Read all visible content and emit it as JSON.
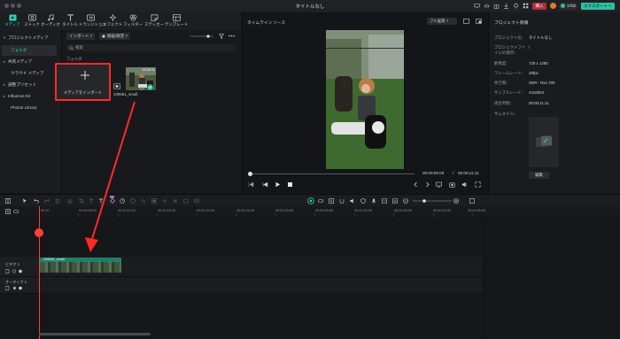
{
  "window": {
    "title": "タイトルなし"
  },
  "titlebar": {
    "buy_label": "購入",
    "credits": "1702",
    "export_label": "エクスポート ˅"
  },
  "toolbar": {
    "items": [
      {
        "label": "メディア"
      },
      {
        "label": "ストック"
      },
      {
        "label": "オーディオ"
      },
      {
        "label": "タイトル"
      },
      {
        "label": "トランジション"
      },
      {
        "label": "エフェクト"
      },
      {
        "label": "フィルター"
      },
      {
        "label": "ステッカー"
      },
      {
        "label": "テンプレート"
      }
    ]
  },
  "sidebar": {
    "items": [
      {
        "label": "プロジェクトメディア",
        "caret": "▾"
      },
      {
        "label": "フォルダ",
        "caret": ""
      },
      {
        "label": "共有メディア",
        "caret": "▸"
      },
      {
        "label": "クラウド メディア",
        "caret": ""
      },
      {
        "label": "調整プリセット",
        "caret": "▸"
      },
      {
        "label": "Influence Kit",
        "caret": "▸"
      },
      {
        "label": "Photos Library",
        "caret": ""
      }
    ]
  },
  "media": {
    "import_dropdown": "インポート ˅",
    "sort_dropdown": "録画/録音 ˅",
    "search_placeholder": "検索",
    "folder_label": "フォルダ",
    "import_card_label": "メディアをインポート",
    "thumb_duration": "00:00:11",
    "thumb_name": "239661_small"
  },
  "preview": {
    "tab_timeline": "タイムライン",
    "tab_source": "ソース",
    "quality": "フル画質 ˅",
    "current_time": "00:00:00:00",
    "separator": "/",
    "total_time": "00:00:11:11"
  },
  "project_info": {
    "title": "プロジェクト情報",
    "fields": [
      {
        "key": "プロジェクト名：",
        "value": "タイトルなし"
      },
      {
        "key": "プロジェクトファイルの場所：",
        "value": "/"
      },
      {
        "key": "解像度：",
        "value": "720 x 1280"
      },
      {
        "key": "フレームレート：",
        "value": "25fps"
      },
      {
        "key": "色空間：",
        "value": "SDR - Rec.709"
      },
      {
        "key": "サンプルレート：",
        "value": "44100Hz"
      },
      {
        "key": "再生時間：",
        "value": "00:00:11:11"
      },
      {
        "key": "サムネイル：",
        "value": ""
      }
    ],
    "edit_label": "編集"
  },
  "timeline": {
    "ruler": [
      "00:00",
      "00:00:05:00",
      "00:00:10:00",
      "00:00:15:00",
      "00:00:20:00",
      "00:00:25:00",
      "00:00:30:00",
      "00:00:35:00",
      "00:00:40:00",
      "00:00:45:00",
      "00:00:50:00",
      "00:00:55:00"
    ],
    "tracks": [
      {
        "label": "ビデオ 1"
      },
      {
        "label": "オーディオ 1"
      }
    ],
    "clip_name": "239661_small"
  },
  "colors": {
    "accent": "#2fbf9f",
    "annotation": "#ff2a2a",
    "buy": "#b32c3a",
    "clip": "#1f7f6a"
  }
}
